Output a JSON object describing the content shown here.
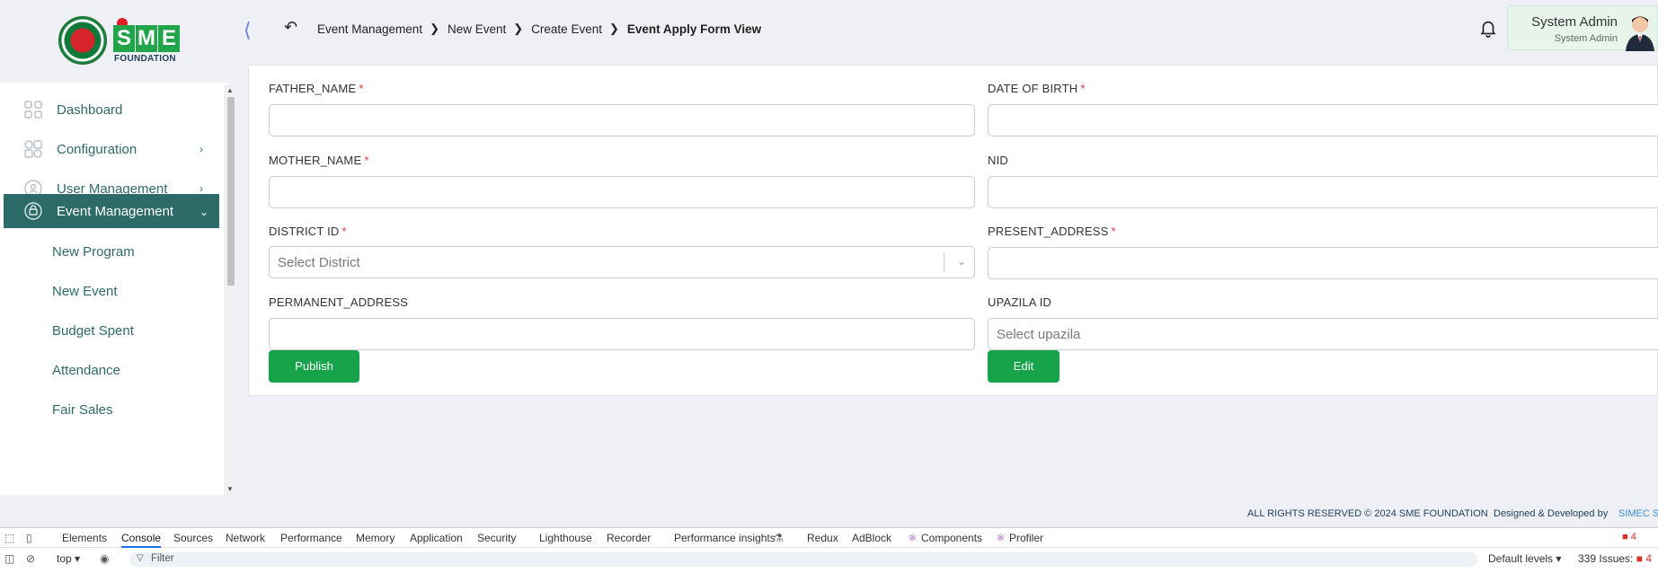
{
  "logo": {
    "brand": "SME",
    "subtitle": "FOUNDATION"
  },
  "header": {
    "breadcrumb": [
      "Event Management",
      "New Event",
      "Create Event",
      "Event Apply Form View"
    ],
    "user_name": "System Admin",
    "user_role": "System Admin"
  },
  "sidebar": {
    "items": [
      {
        "label": "Dashboard",
        "icon": "grid-icon",
        "has_chevron": false
      },
      {
        "label": "Configuration",
        "icon": "config-icon",
        "has_chevron": true
      },
      {
        "label": "User Management",
        "icon": "user-shield-icon",
        "has_chevron": true
      },
      {
        "label": "Event Management",
        "icon": "event-icon",
        "has_chevron": true,
        "active": true
      }
    ],
    "sub_items": [
      "New Program",
      "New Event",
      "Budget Spent",
      "Attendance",
      "Fair Sales"
    ]
  },
  "form": {
    "father_name": {
      "label": "FATHER_NAME",
      "required": "*"
    },
    "date_of_birth": {
      "label": "DATE OF BIRTH",
      "required": "*"
    },
    "mother_name": {
      "label": "MOTHER_NAME",
      "required": "*"
    },
    "nid": {
      "label": "NID"
    },
    "district": {
      "label": "DISTRICT ID",
      "required": "*",
      "placeholder": "Select District"
    },
    "present_address": {
      "label": "PRESENT_ADDRESS",
      "required": "*"
    },
    "permanent_address": {
      "label": "PERMANENT_ADDRESS"
    },
    "upazila": {
      "label": "UPAZILA ID",
      "placeholder": "Select upazila"
    },
    "publish_label": "Publish",
    "edit_label": "Edit"
  },
  "footer": {
    "copyright": "ALL RIGHTS RESERVED © 2024 SME FOUNDATION",
    "designed_by": "Designed & Developed by",
    "company": "SIMEC S"
  },
  "devtools": {
    "tabs": [
      "Elements",
      "Console",
      "Sources",
      "Network",
      "Performance",
      "Memory",
      "Application",
      "Security",
      "Lighthouse",
      "Recorder",
      "Performance insights",
      "Redux",
      "AdBlock",
      "Components",
      "Profiler"
    ],
    "active_tab": "Console",
    "context": "top",
    "filter_placeholder": "Filter",
    "levels": "Default levels",
    "issues": "339 Issues:",
    "error_count": "4",
    "issue_count": "4"
  },
  "colors": {
    "brand_green": "#16a34a",
    "sidebar_active": "#2c6b68",
    "text_teal": "#2f6a6a",
    "required_red": "#d9363e"
  }
}
